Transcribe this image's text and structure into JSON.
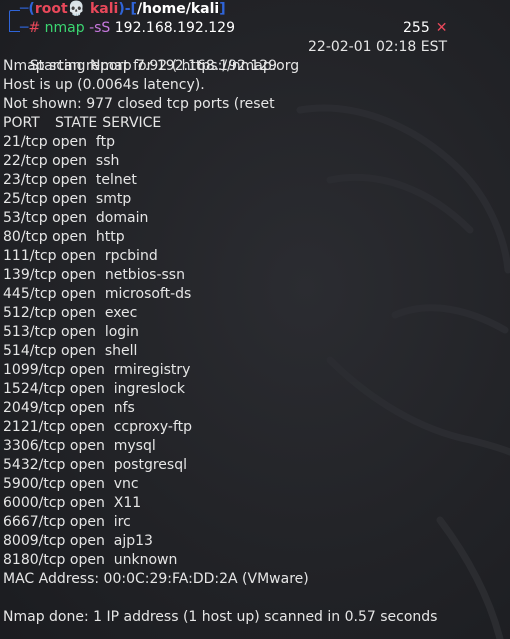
{
  "prompt": {
    "user": "root",
    "skull": "💀",
    "host": "kali",
    "path": "/home/kali",
    "symbol": "#",
    "command": "nmap",
    "flag": "-sS",
    "target": "192.168.192.129",
    "exit_code": "255",
    "exit_mark": "✕"
  },
  "output": {
    "starting": "Starting Nmap 7.92 ( https://nmap.org",
    "date_fragment": "22-02-01 02:18 EST",
    "report": "Nmap scan report for 192.168.192.129",
    "host_up": "Host is up (0.0064s latency).",
    "not_shown": "Not shown: 977 closed tcp ports (reset",
    "header": {
      "port": "PORT",
      "state": "STATE",
      "service": "SERVICE"
    },
    "ports": [
      {
        "port": "21/tcp",
        "state": "open",
        "service": "ftp"
      },
      {
        "port": "22/tcp",
        "state": "open",
        "service": "ssh"
      },
      {
        "port": "23/tcp",
        "state": "open",
        "service": "telnet"
      },
      {
        "port": "25/tcp",
        "state": "open",
        "service": "smtp"
      },
      {
        "port": "53/tcp",
        "state": "open",
        "service": "domain"
      },
      {
        "port": "80/tcp",
        "state": "open",
        "service": "http"
      },
      {
        "port": "111/tcp",
        "state": "open",
        "service": "rpcbind"
      },
      {
        "port": "139/tcp",
        "state": "open",
        "service": "netbios-ssn"
      },
      {
        "port": "445/tcp",
        "state": "open",
        "service": "microsoft-ds"
      },
      {
        "port": "512/tcp",
        "state": "open",
        "service": "exec"
      },
      {
        "port": "513/tcp",
        "state": "open",
        "service": "login"
      },
      {
        "port": "514/tcp",
        "state": "open",
        "service": "shell"
      },
      {
        "port": "1099/tcp",
        "state": "open",
        "service": "rmiregistry"
      },
      {
        "port": "1524/tcp",
        "state": "open",
        "service": "ingreslock"
      },
      {
        "port": "2049/tcp",
        "state": "open",
        "service": "nfs"
      },
      {
        "port": "2121/tcp",
        "state": "open",
        "service": "ccproxy-ftp"
      },
      {
        "port": "3306/tcp",
        "state": "open",
        "service": "mysql"
      },
      {
        "port": "5432/tcp",
        "state": "open",
        "service": "postgresql"
      },
      {
        "port": "5900/tcp",
        "state": "open",
        "service": "vnc"
      },
      {
        "port": "6000/tcp",
        "state": "open",
        "service": "X11"
      },
      {
        "port": "6667/tcp",
        "state": "open",
        "service": "irc"
      },
      {
        "port": "8009/tcp",
        "state": "open",
        "service": "ajp13"
      },
      {
        "port": "8180/tcp",
        "state": "open",
        "service": "unknown"
      }
    ],
    "mac": "MAC Address: 00:0C:29:FA:DD:2A (VMware)",
    "done": "Nmap done: 1 IP address (1 host up) scanned in 0.57 seconds"
  },
  "colors": {
    "background": "#222327",
    "prompt_frame": "#2f64d8",
    "user": "#e8485a",
    "command": "#3bd671",
    "flag": "#c678dd"
  }
}
